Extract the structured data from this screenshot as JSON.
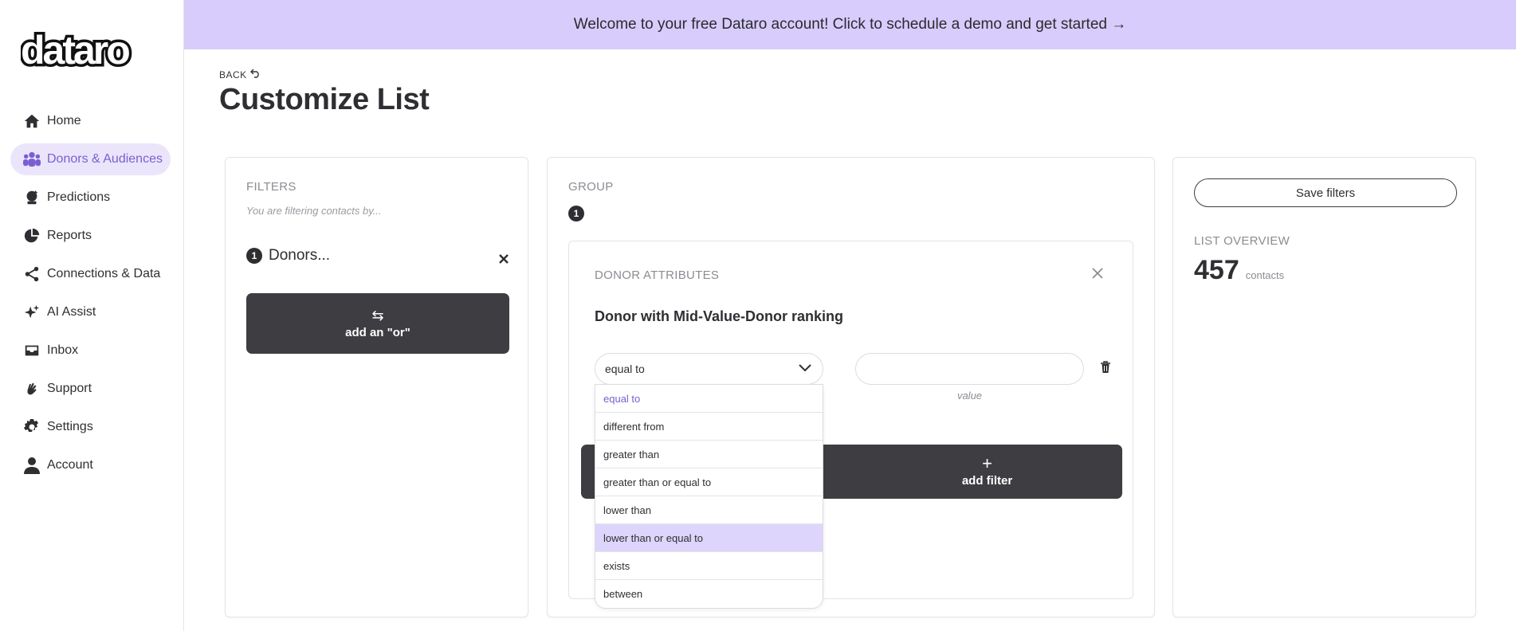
{
  "brand": {
    "logo_text": "dataro",
    "accent": "#7a5fd0",
    "banner_bg": "#d7ccfb"
  },
  "banner": {
    "text": "Welcome to your free Dataro account! Click to schedule a demo and get started →"
  },
  "sidebar": {
    "items": [
      {
        "label": "Home",
        "icon": "home-icon",
        "active": false
      },
      {
        "label": "Donors & Audiences",
        "icon": "people-icon",
        "active": true
      },
      {
        "label": "Predictions",
        "icon": "crystal-ball-icon",
        "active": false
      },
      {
        "label": "Reports",
        "icon": "pie-chart-icon",
        "active": false
      },
      {
        "label": "Connections & Data",
        "icon": "share-icon",
        "active": false
      },
      {
        "label": "AI Assist",
        "icon": "sparkle-icon",
        "active": false
      },
      {
        "label": "Inbox",
        "icon": "inbox-icon",
        "active": false
      },
      {
        "label": "Support",
        "icon": "waving-hand-icon",
        "active": false
      },
      {
        "label": "Settings",
        "icon": "gear-icon",
        "active": false
      },
      {
        "label": "Account",
        "icon": "user-icon",
        "active": false
      }
    ]
  },
  "header": {
    "back_label": "BACK",
    "title": "Customize List"
  },
  "filters_panel": {
    "label": "FILTERS",
    "subtitle": "You are filtering contacts by...",
    "filter": {
      "number": "1",
      "text": "Donors..."
    },
    "add_or_label": "add an \"or\""
  },
  "group_panel": {
    "label": "GROUP",
    "number": "1",
    "card": {
      "label": "DONOR ATTRIBUTES",
      "title": "Donor with Mid-Value-Donor ranking",
      "operator_value": "equal to",
      "value_input": "",
      "value_caption": "value",
      "add_filter_label": "add filter"
    },
    "dropdown_options": [
      {
        "label": "equal to",
        "selected": true,
        "hover": false
      },
      {
        "label": "different from",
        "selected": false,
        "hover": false
      },
      {
        "label": "greater than",
        "selected": false,
        "hover": false
      },
      {
        "label": "greater than or equal to",
        "selected": false,
        "hover": false
      },
      {
        "label": "lower than",
        "selected": false,
        "hover": false
      },
      {
        "label": "lower than or equal to",
        "selected": false,
        "hover": true
      },
      {
        "label": "exists",
        "selected": false,
        "hover": false
      },
      {
        "label": "between",
        "selected": false,
        "hover": false
      }
    ]
  },
  "overview_panel": {
    "save_label": "Save filters",
    "label": "LIST OVERVIEW",
    "count": "457",
    "count_unit": "contacts"
  }
}
